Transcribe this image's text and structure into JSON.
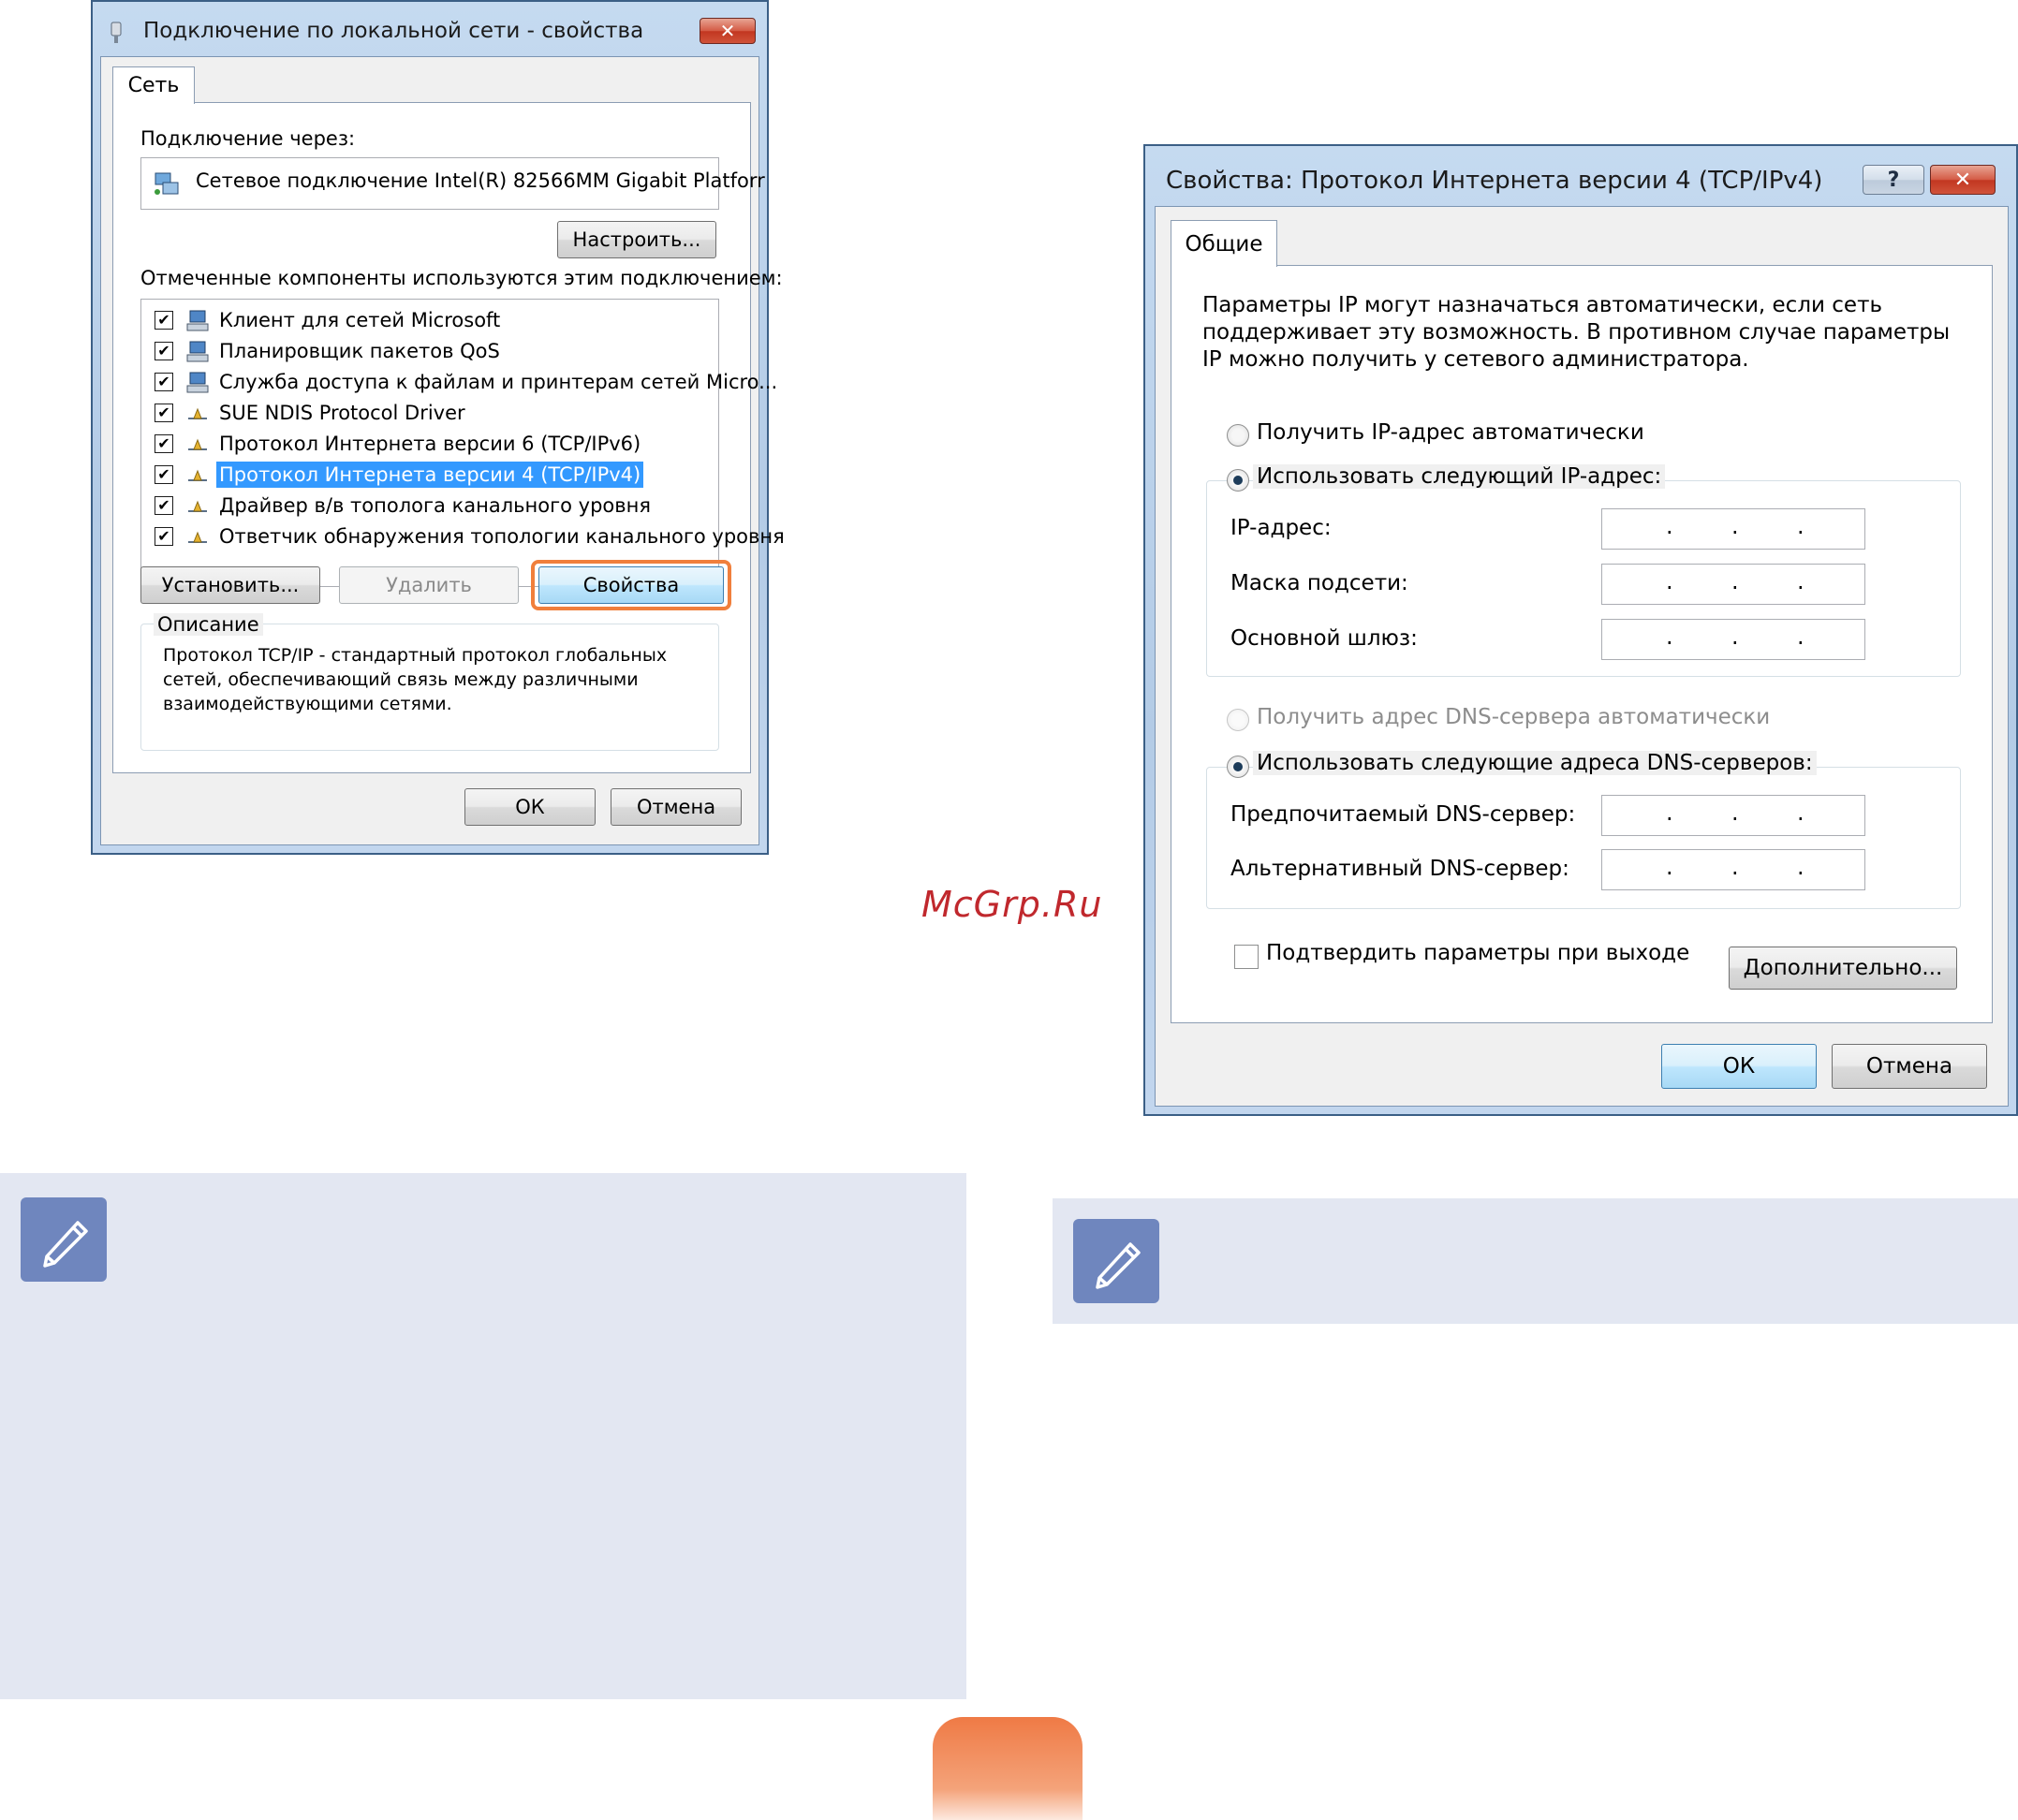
{
  "dialog1": {
    "title": "Подключение по локальной сети - свойства",
    "tab": "Сеть",
    "connect_via_label": "Подключение через:",
    "adapter_name": "Сетевое подключение Intel(R) 82566MM Gigabit Platforr",
    "configure_button": "Настроить...",
    "components_label": "Отмеченные компоненты используются этим подключением:",
    "components": [
      {
        "label": "Клиент для сетей Microsoft",
        "checked": true,
        "icon": "network-client-icon"
      },
      {
        "label": "Планировщик пакетов QoS",
        "checked": true,
        "icon": "network-service-icon"
      },
      {
        "label": "Служба доступа к файлам и принтерам сетей Micro...",
        "checked": true,
        "icon": "network-service-icon"
      },
      {
        "label": "SUE NDIS Protocol Driver",
        "checked": true,
        "icon": "protocol-icon"
      },
      {
        "label": "Протокол Интернета версии 6 (TCP/IPv6)",
        "checked": true,
        "icon": "protocol-icon"
      },
      {
        "label": "Протокол Интернета версии 4 (TCP/IPv4)",
        "checked": true,
        "icon": "protocol-icon",
        "selected": true
      },
      {
        "label": "Драйвер в/в тополога канального уровня",
        "checked": true,
        "icon": "protocol-icon"
      },
      {
        "label": "Ответчик обнаружения топологии канального уровня",
        "checked": true,
        "icon": "protocol-icon"
      }
    ],
    "install_button": "Установить...",
    "remove_button": "Удалить",
    "properties_button": "Свойства",
    "description_label": "Описание",
    "description_lines": [
      "Протокол TCP/IP - стандартный протокол глобальных",
      "сетей, обеспечивающий связь между различными",
      "взаимодействующими сетями."
    ],
    "ok_button": "ОК",
    "cancel_button": "Отмена"
  },
  "dialog2": {
    "title": "Свойства: Протокол Интернета версии 4 (TCP/IPv4)",
    "help_glyph": "?",
    "tab": "Общие",
    "intro_lines": [
      "Параметры IP могут назначаться автоматически, если сеть",
      "поддерживает эту возможность. В противном случае параметры",
      "IP можно получить у сетевого администратора."
    ],
    "radio_auto_ip": "Получить IP-адрес автоматически",
    "radio_manual_ip": "Использовать следующий IP-адрес:",
    "ip_label": "IP-адрес:",
    "mask_label": "Маска подсети:",
    "gateway_label": "Основной шлюз:",
    "radio_auto_dns": "Получить адрес DNS-сервера автоматически",
    "radio_manual_dns": "Использовать следующие адреса DNS-серверов:",
    "dns_preferred_label": "Предпочитаемый DNS-сервер:",
    "dns_alternate_label": "Альтернативный DNS-сервер:",
    "validate_checkbox": "Подтвердить параметры при выходе",
    "advanced_button": "Дополнительно...",
    "ok_button": "ОК",
    "cancel_button": "Отмена",
    "ip_value": ". . .",
    "selected_ip_mode": "manual",
    "selected_dns_mode": "manual",
    "validate_checked": false
  },
  "watermark": "McGrp.Ru",
  "colors": {
    "accent_highlight": "#f07f3c",
    "note_bg": "#e3e7f2",
    "note_icon": "#6f86be",
    "selection": "#3399ff",
    "watermark": "#c0282d"
  },
  "icons": {
    "note": "pencil-note-icon",
    "close": "close-icon",
    "help": "help-icon",
    "window": "network-adapter-icon"
  }
}
